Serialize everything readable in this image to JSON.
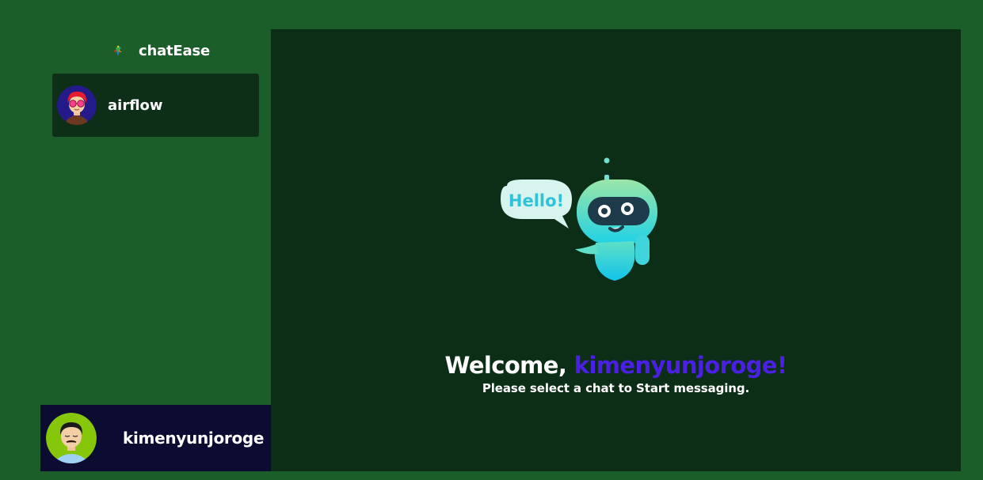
{
  "app": {
    "name": "chatEase",
    "logo_icon": "parrot-logo-icon"
  },
  "sidebar": {
    "chats": [
      {
        "name": "airflow",
        "avatar_icon": "avatar-red-hair-glasses-icon"
      }
    ]
  },
  "current_user": {
    "username": "kimenyunjoroge",
    "avatar_icon": "avatar-man-mustache-icon"
  },
  "main": {
    "illustration_icon": "hello-robot-icon",
    "bubble_text": "Hello!",
    "welcome_prefix": "Welcome, ",
    "welcome_username": "kimenyunjoroge!",
    "subtitle": "Please select a chat to Start messaging."
  },
  "colors": {
    "page_bg": "#1b5e2a",
    "panel_bg": "#0c2e17",
    "chat_item_bg": "#0d2e17",
    "user_bar_bg": "#0c0c33",
    "accent_username": "#4b1fe6"
  }
}
